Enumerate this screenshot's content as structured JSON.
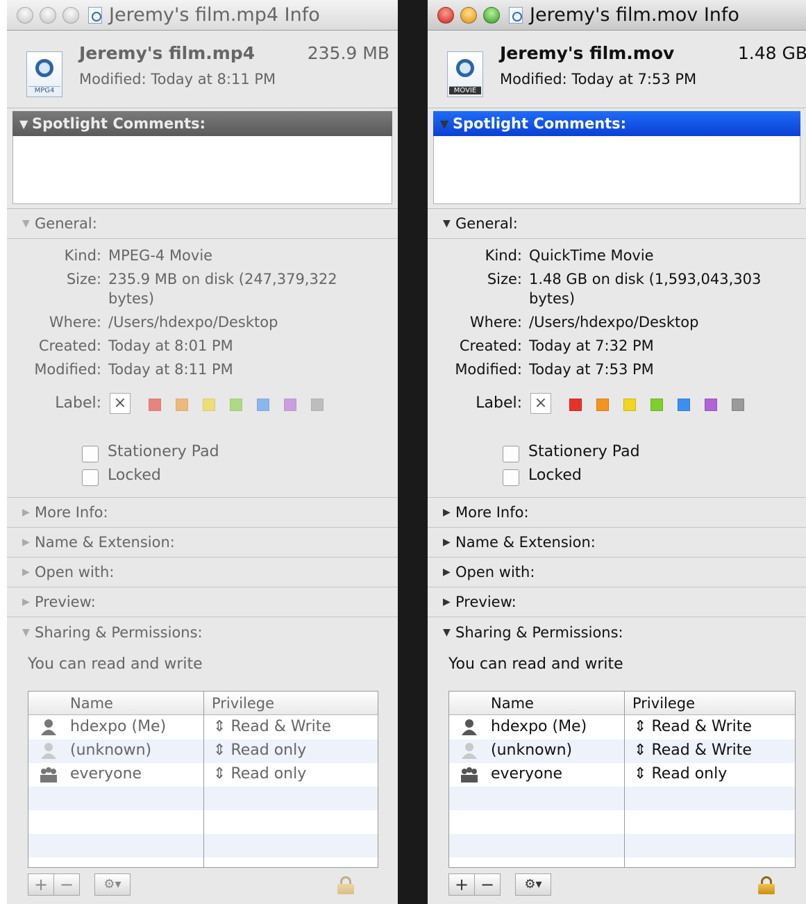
{
  "colors": {
    "spotlight_active": "#0a3fd6",
    "spotlight_inactive": "#6a6a6a",
    "labels": [
      "#e8322a",
      "#f29420",
      "#f0d61f",
      "#7fcf2c",
      "#3c8ff2",
      "#b064d6",
      "#9a9a9a"
    ]
  },
  "windows": [
    {
      "title": "Jeremy's film.mp4 Info",
      "file_name": "Jeremy's film.mp4",
      "file_size": "235.9 MB",
      "modified_line": "Modified: Today at 8:11 PM",
      "icon_tag": "MPG4",
      "spotlight": "Spotlight Comments:",
      "general_head": "General:",
      "kind_label": "Kind:",
      "kind": "MPEG-4 Movie",
      "size_label": "Size:",
      "size_line1": "235.9 MB on disk (247,379,322",
      "size_line2": "bytes)",
      "where_label": "Where:",
      "where": "/Users/hdexpo/Desktop",
      "created_label": "Created:",
      "created": "Today at 8:01 PM",
      "modified_label": "Modified:",
      "modified": "Today at 8:11 PM",
      "label_label": "Label:",
      "clear_label": "×",
      "stationery": "Stationery Pad",
      "locked": "Locked",
      "more_info": "More Info:",
      "name_ext": "Name & Extension:",
      "open_with": "Open with:",
      "preview": "Preview:",
      "sharing": "Sharing & Permissions:",
      "sharing_text": "You can read and write",
      "col_name": "Name",
      "col_priv": "Privilege",
      "rows": [
        {
          "name": "hdexpo (Me)",
          "priv": "Read & Write"
        },
        {
          "name": "(unknown)",
          "priv": "Read only"
        },
        {
          "name": "everyone",
          "priv": "Read only"
        }
      ],
      "add": "+",
      "remove": "−",
      "action": "⚙▾"
    },
    {
      "title": "Jeremy's film.mov Info",
      "file_name": "Jeremy's film.mov",
      "file_size": "1.48 GB",
      "modified_line": "Modified: Today at 7:53 PM",
      "icon_tag": "MOVIE",
      "spotlight": "Spotlight Comments:",
      "general_head": "General:",
      "kind_label": "Kind:",
      "kind": "QuickTime Movie",
      "size_label": "Size:",
      "size_line1": "1.48 GB on disk (1,593,043,303",
      "size_line2": "bytes)",
      "where_label": "Where:",
      "where": "/Users/hdexpo/Desktop",
      "created_label": "Created:",
      "created": "Today at 7:32 PM",
      "modified_label": "Modified:",
      "modified": "Today at 7:53 PM",
      "label_label": "Label:",
      "clear_label": "×",
      "stationery": "Stationery Pad",
      "locked": "Locked",
      "more_info": "More Info:",
      "name_ext": "Name & Extension:",
      "open_with": "Open with:",
      "preview": "Preview:",
      "sharing": "Sharing & Permissions:",
      "sharing_text": "You can read and write",
      "col_name": "Name",
      "col_priv": "Privilege",
      "rows": [
        {
          "name": "hdexpo (Me)",
          "priv": "Read & Write"
        },
        {
          "name": "(unknown)",
          "priv": "Read & Write"
        },
        {
          "name": "everyone",
          "priv": "Read only"
        }
      ],
      "add": "+",
      "remove": "−",
      "action": "⚙▾"
    }
  ]
}
